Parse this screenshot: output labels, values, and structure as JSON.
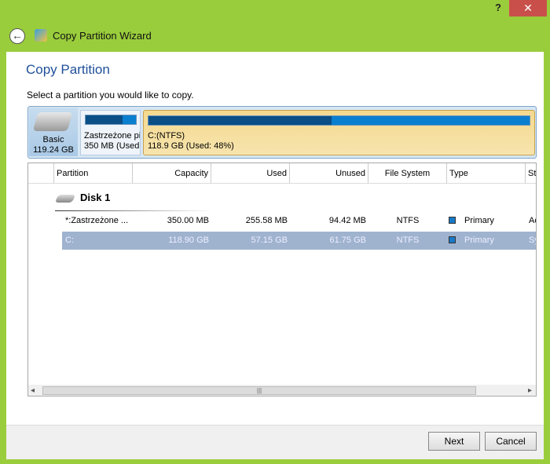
{
  "window": {
    "title": "Copy Partition Wizard",
    "help": "?",
    "close": "✕",
    "back": "←"
  },
  "page": {
    "title": "Copy Partition",
    "instruction": "Select a partition you would like to copy."
  },
  "disk_map": {
    "disk": {
      "label": "Basic",
      "size": "119.24 GB"
    },
    "partitions": [
      {
        "name": "Zastrzeżone pi",
        "info": "350 MB (Used:",
        "used_percent": 73
      },
      {
        "name": "C:(NTFS)",
        "info": "118.9 GB (Used: 48%)",
        "used_percent": 48
      }
    ]
  },
  "table": {
    "columns": [
      "Partition",
      "Capacity",
      "Used",
      "Unused",
      "File System",
      "Type",
      "St"
    ],
    "disk_label": "Disk 1",
    "rows": [
      {
        "partition": "*:Zastrzeżone ...",
        "capacity": "350.00 MB",
        "used": "255.58 MB",
        "unused": "94.42 MB",
        "fs": "NTFS",
        "type": "Primary",
        "status": "Ac",
        "selected": false
      },
      {
        "partition": "C:",
        "capacity": "118.90 GB",
        "used": "57.15 GB",
        "unused": "61.75 GB",
        "fs": "NTFS",
        "type": "Primary",
        "status": "Sy",
        "selected": true
      }
    ],
    "scroll": {
      "left": "◂",
      "right": "▸",
      "grip": "|||"
    }
  },
  "footer": {
    "next": "Next",
    "cancel": "Cancel"
  },
  "colors": {
    "frame": "#9acd3c",
    "selected_row": "#9fb3cf",
    "primary_square": "#1a79c6"
  }
}
